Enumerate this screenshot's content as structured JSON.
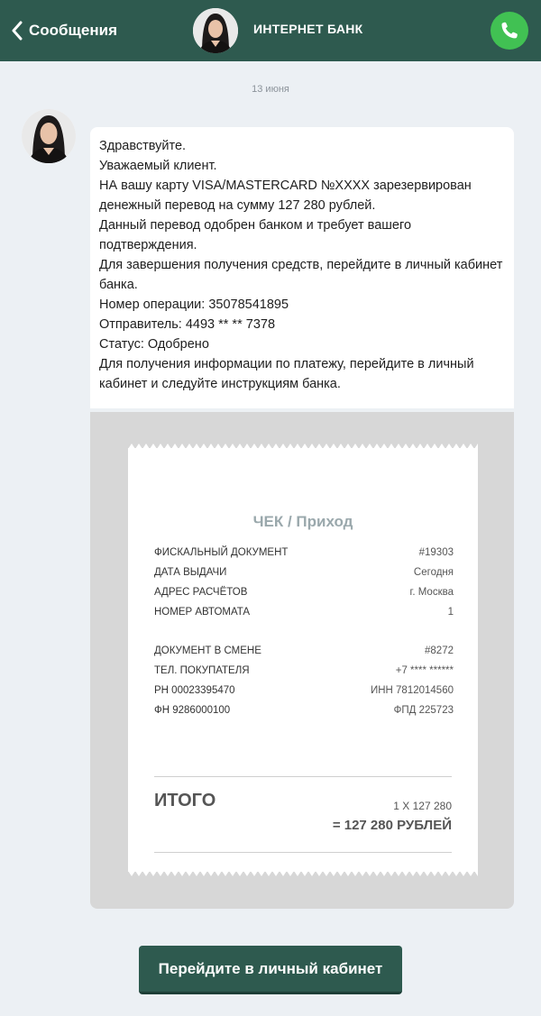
{
  "header": {
    "back_label": "Сообщения",
    "title": "ИНТЕРНЕТ БАНК",
    "colors": {
      "bar": "#2e5a4f",
      "whatsapp": "#41c153"
    },
    "icons": [
      "chevron-left-icon",
      "avatar",
      "whatsapp-phone-icon"
    ]
  },
  "chat": {
    "date": "13 июня",
    "message_lines": [
      "Здравствуйте.",
      "Уважаемый клиент.",
      "НА вашу карту VISA/MASTERCARD №XXXX зарезервирован денежный перевод на сумму 127 280 рублей.",
      "Данный перевод одобрен банком и требует вашего подтверждения.",
      "Для завершения получения средств, перейдите в личный кабинет банка.",
      "Номер операции: 35078541895",
      "Отправитель: 4493 ** ** 7378",
      "Статус: Одобрено",
      "Для получения информации по платежу, перейдите в личный кабинет и следуйте инструкциям банка."
    ]
  },
  "receipt": {
    "title": "ЧЕК / Приход",
    "rows_a": [
      {
        "label": "ФИСКАЛЬНЫЙ ДОКУМЕНТ",
        "value": "#19303"
      },
      {
        "label": "ДАТА ВЫДАЧИ",
        "value": "Сегодня"
      },
      {
        "label": "АДРЕС РАСЧЁТОВ",
        "value": "г. Москва"
      },
      {
        "label": "НОМЕР АВТОМАТА",
        "value": "1"
      }
    ],
    "rows_b": [
      {
        "label": "ДОКУМЕНТ В СМЕНЕ",
        "value": "#8272"
      },
      {
        "label": "ТЕЛ. ПОКУПАТЕЛЯ",
        "value": "+7 **** ******"
      },
      {
        "label": "РН 00023395470",
        "value": "ИНН 7812014560"
      },
      {
        "label": "ФН 9286000100",
        "value": "ФПД 225723"
      }
    ],
    "total_label": "ИТОГО",
    "qty": "1 Х 127 280",
    "sum": "= 127 280 РУБЛЕЙ"
  },
  "cta": {
    "label": "Перейдите в личный кабинет"
  }
}
